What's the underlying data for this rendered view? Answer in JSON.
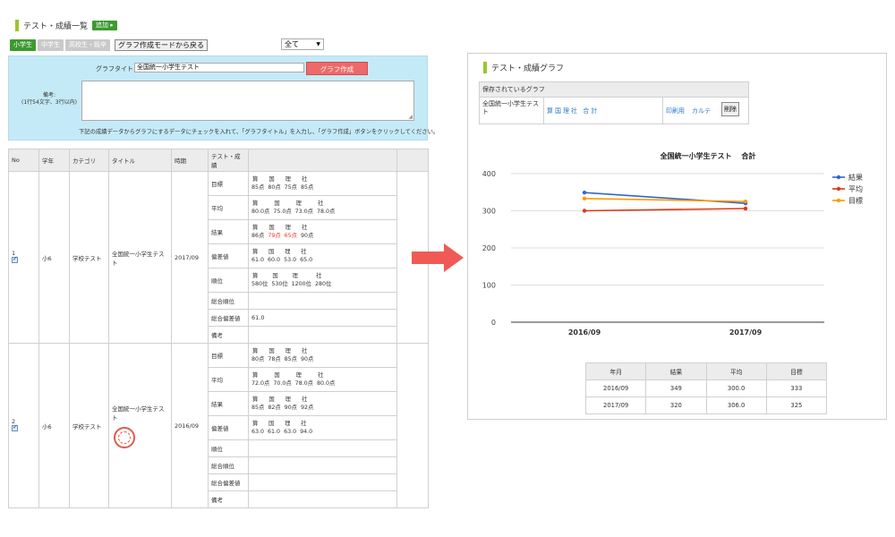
{
  "list": {
    "title": "テスト・成績一覧",
    "add_label": "追加 ▸",
    "tabs": [
      "小学生",
      "中学生",
      "高校生・既卒"
    ],
    "back_label": "グラフ作成モードから戻る",
    "filter_value": "全て"
  },
  "form": {
    "title_label": "グラフタイトル:",
    "title_value": "全国統一小学生テスト",
    "create_label": "グラフ作成",
    "memo_label": "備考:",
    "memo_hint": "(1行54文字、3行以内)",
    "instruction": "下記の成績データからグラフにするデータにチェックを入れて、「グラフタイトル」を入力し、「グラフ作成」ボタンをクリックしてください。"
  },
  "table": {
    "headers": [
      "No",
      "学年",
      "カテゴリ",
      "タイトル",
      "時期",
      "テスト・成績"
    ],
    "subjects": [
      "算",
      "国",
      "理",
      "社"
    ],
    "labels": {
      "target": "目標",
      "average": "平均",
      "result": "結果",
      "deviation": "偏差値",
      "rank": "順位",
      "total_rank": "総合順位",
      "total_dev": "総合偏差値",
      "note": "備考"
    },
    "rows": [
      {
        "no": "1",
        "grade": "小6",
        "category": "学校テスト",
        "title": "全国統一小学生テスト",
        "period": "2017/09",
        "target": [
          "85点",
          "80点",
          "75点",
          "85点"
        ],
        "average": [
          "80.0点",
          "75.0点",
          "73.0点",
          "78.0点"
        ],
        "result": [
          "86点",
          "79点",
          "65点",
          "90点"
        ],
        "deviation": [
          "61.0",
          "60.0",
          "53.0",
          "65.0"
        ],
        "rank": [
          "580位",
          "530位",
          "1200位",
          "280位"
        ],
        "total_rank": "",
        "total_dev": "61.0",
        "note": ""
      },
      {
        "no": "2",
        "grade": "小6",
        "category": "学校テスト",
        "title": "全国統一小学生テスト",
        "period": "2016/09",
        "target": [
          "80点",
          "78点",
          "85点",
          "90点"
        ],
        "average": [
          "72.0点",
          "70.0点",
          "78.0点",
          "80.0点"
        ],
        "result": [
          "85点",
          "82点",
          "90点",
          "92点"
        ],
        "deviation": [
          "63.0",
          "61.0",
          "63.0",
          "94.0"
        ],
        "rank": [],
        "total_rank": "",
        "total_dev": "",
        "note": ""
      }
    ]
  },
  "graph_panel": {
    "title": "テスト・成績グラフ",
    "saved_header": "保存されているグラフ",
    "saved_name": "全国統一小学生テスト",
    "saved_subjects": "算国理社 合計",
    "print_label": "印刷用",
    "karte_label": "カルテ",
    "delete_label": "削除"
  },
  "chart_data": {
    "type": "line",
    "title": "全国統一小学生テスト　 合計",
    "categories": [
      "2016/09",
      "2017/09"
    ],
    "series": [
      {
        "name": "結果",
        "color": "#3266cc",
        "values": [
          349,
          320
        ]
      },
      {
        "name": "平均",
        "color": "#dc3912",
        "values": [
          300,
          306
        ]
      },
      {
        "name": "目標",
        "color": "#ff9900",
        "values": [
          333,
          325
        ]
      }
    ],
    "yticks": [
      0,
      100,
      200,
      300,
      400
    ],
    "ylim": [
      0,
      400
    ],
    "grid": true,
    "legend": "right"
  },
  "summary": {
    "headers": [
      "年月",
      "結果",
      "平均",
      "目標"
    ],
    "rows": [
      [
        "2016/09",
        "349",
        "300.0",
        "333"
      ],
      [
        "2017/09",
        "320",
        "306.0",
        "325"
      ]
    ]
  }
}
